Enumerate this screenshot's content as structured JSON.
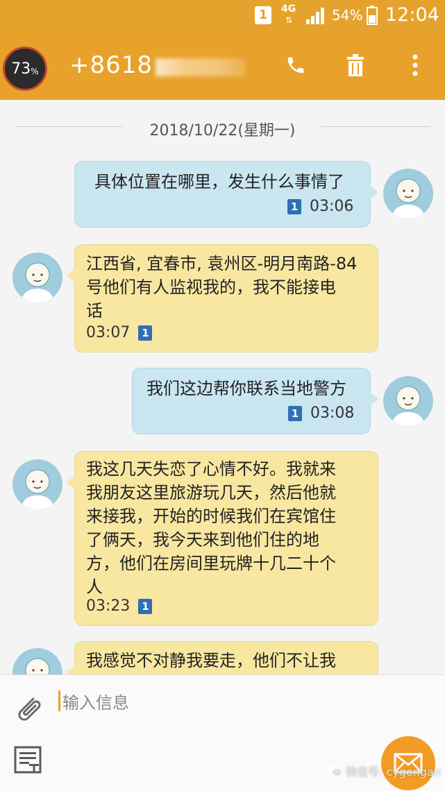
{
  "status_bar": {
    "sim_slot": "1",
    "network": "4G",
    "network_arrows": "⇅",
    "battery": "54%",
    "time": "12:04"
  },
  "header": {
    "badge_percent": "73",
    "badge_sign": "%",
    "contact_visible": "+8618",
    "call_icon": "phone-icon",
    "delete_icon": "trash-icon",
    "menu_icon": "more-vertical-icon"
  },
  "chat": {
    "date": "2018/10/22(星期一)",
    "messages": [
      {
        "dir": "out",
        "lines": [
          "具体位置在哪里，发生什么事情了"
        ],
        "sim": "1",
        "time": "03:06"
      },
      {
        "dir": "in",
        "lines": [
          "江西省, 宜春市, 袁州区-明月南路-84",
          "号他们有人监视我的，我不能接电",
          "话"
        ],
        "sim": "1",
        "time": "03:07"
      },
      {
        "dir": "out",
        "lines": [
          "我们这边帮你联系当地警方"
        ],
        "sim": "1",
        "time": "03:08"
      },
      {
        "dir": "in",
        "lines": [
          "我这几天失恋了心情不好。我就来",
          "我朋友这里旅游玩几天，然后他就",
          "来接我，开始的时候我们在宾馆住",
          "了俩天，我今天来到他们住的地",
          "方，他们在房间里玩牌十几二十个",
          "人"
        ],
        "sim": "1",
        "time": "03:23"
      },
      {
        "dir": "in",
        "lines": [
          "我感觉不对静我要走，他们不让我"
        ],
        "sim": "",
        "time": ""
      }
    ]
  },
  "composer": {
    "placeholder": "输入信息",
    "attach_icon": "paperclip-icon",
    "template_icon": "text-template-icon",
    "send_icon": "envelope-icon"
  },
  "watermark": {
    "text": "微信号: cygongan"
  },
  "colors": {
    "header": "#e8a22c",
    "bubble_out": "#c9e6f1",
    "bubble_in": "#f8e7a1",
    "sim_chip": "#2f6fb4",
    "send_button": "#f39c25"
  }
}
